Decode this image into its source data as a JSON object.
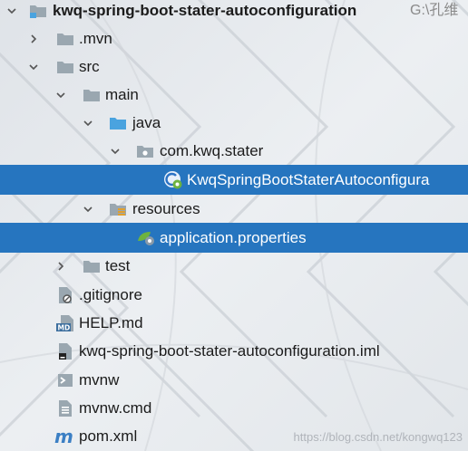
{
  "tree": {
    "root": {
      "label": "kwq-spring-boot-stater-autoconfiguration",
      "path_hint": "G:\\孔维"
    },
    "mvn": {
      "label": ".mvn"
    },
    "src": {
      "label": "src"
    },
    "main": {
      "label": "main"
    },
    "java": {
      "label": "java"
    },
    "package": {
      "label": "com.kwq.stater"
    },
    "autoconfig_class": {
      "label": "KwqSpringBootStaterAutoconfigura"
    },
    "resources": {
      "label": "resources"
    },
    "application_properties": {
      "label": "application.properties"
    },
    "test": {
      "label": "test"
    },
    "gitignore": {
      "label": ".gitignore"
    },
    "help_md": {
      "label": "HELP.md"
    },
    "iml": {
      "label": "kwq-spring-boot-stater-autoconfiguration.iml"
    },
    "mvnw": {
      "label": "mvnw"
    },
    "mvnw_cmd": {
      "label": "mvnw.cmd"
    },
    "pom": {
      "label": "pom.xml"
    }
  },
  "watermark": "https://blog.csdn.net/kongwq123",
  "colors": {
    "selection": "#2675bf",
    "folder": "#9aa7b0",
    "source_folder": "#4aa3df",
    "spring_green": "#6db33f"
  },
  "icons": {
    "root": "module-folder-icon",
    "mvn": "folder-icon",
    "src": "folder-icon",
    "main": "folder-icon",
    "java": "source-folder-icon",
    "package": "package-icon",
    "autoconfig_class": "spring-config-class-icon",
    "resources": "resources-folder-icon",
    "application_properties": "spring-properties-icon",
    "test": "folder-icon",
    "gitignore": "ignored-file-icon",
    "help_md": "markdown-file-icon",
    "iml": "module-file-icon",
    "mvnw": "shell-script-icon",
    "mvnw_cmd": "text-file-icon",
    "pom": "maven-pom-icon"
  }
}
